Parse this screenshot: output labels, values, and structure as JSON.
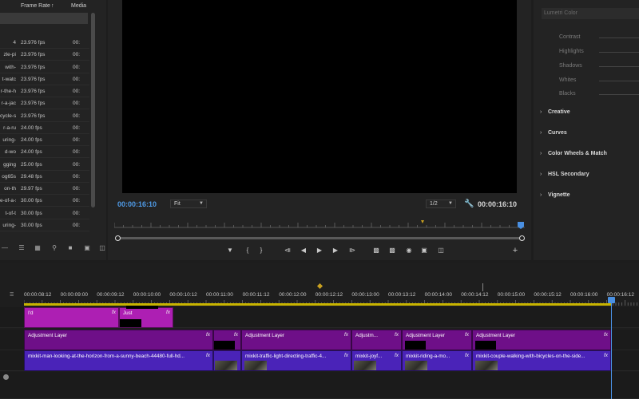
{
  "project": {
    "headers": {
      "frame_rate": "Frame Rate",
      "media": "Media"
    },
    "rows": [
      {
        "name": "4",
        "fps": "23.976 fps",
        "media": "00:"
      },
      {
        "name": "zle-pi",
        "fps": "23.976 fps",
        "media": "00:"
      },
      {
        "name": "with-",
        "fps": "23.976 fps",
        "media": "00:"
      },
      {
        "name": "t-watc",
        "fps": "23.976 fps",
        "media": "00:"
      },
      {
        "name": "r-the-h",
        "fps": "23.976 fps",
        "media": "00:"
      },
      {
        "name": "r-a-jac",
        "fps": "23.976 fps",
        "media": "00:"
      },
      {
        "name": "cycle-s",
        "fps": "23.976 fps",
        "media": "00:"
      },
      {
        "name": "r-a-ru",
        "fps": "24.00 fps",
        "media": "00:"
      },
      {
        "name": "uring-",
        "fps": "24.00 fps",
        "media": "00:"
      },
      {
        "name": "d-wo",
        "fps": "24.00 fps",
        "media": "00:"
      },
      {
        "name": "gging",
        "fps": "25.00 fps",
        "media": "00:"
      },
      {
        "name": "og65s",
        "fps": "29.48 fps",
        "media": "00:"
      },
      {
        "name": "on-th",
        "fps": "29.97 fps",
        "media": "00:"
      },
      {
        "name": "e-of-a-s",
        "fps": "30.00 fps",
        "media": "00:"
      },
      {
        "name": "t-of-t",
        "fps": "30.00 fps",
        "media": "00:"
      },
      {
        "name": "uring-",
        "fps": "30.00 fps",
        "media": "00:"
      }
    ]
  },
  "program": {
    "timecode_current": "00:00:16:10",
    "zoom": "Fit",
    "resolution": "1/2",
    "timecode_duration": "00:00:16:10"
  },
  "lumetri": {
    "clip_selector": "Lumetri Color",
    "sliders": [
      "Contrast",
      "Highlights",
      "Shadows",
      "Whites",
      "Blacks"
    ],
    "sections": [
      "Creative",
      "Curves",
      "Color Wheels & Match",
      "HSL Secondary",
      "Vignette"
    ]
  },
  "timeline": {
    "timecodes": [
      "00:00:08:12",
      "00:00:09:00",
      "00:00:09:12",
      "00:00:10:00",
      "00:00:10:12",
      "00:00:11:00",
      "00:00:11:12",
      "00:00:12:00",
      "00:00:12:12",
      "00:00:13:00",
      "00:00:13:12",
      "00:00:14:00",
      "00:00:14:12",
      "00:00:15:00",
      "00:00:15:12",
      "00:00:16:00",
      "00:00:16:12"
    ],
    "v3_clips": [
      {
        "label": "I'd",
        "fx": "fx"
      },
      {
        "label": "Just",
        "fx": "fx"
      }
    ],
    "v2_clips": [
      {
        "label": "Adjustment Layer",
        "fx": "fx"
      },
      {
        "label": "",
        "fx": "fx"
      },
      {
        "label": "Adjustment Layer",
        "fx": "fx"
      },
      {
        "label": "Adjustm...",
        "fx": "fx"
      },
      {
        "label": "Adjustment Layer",
        "fx": "fx"
      },
      {
        "label": "Adjustment Layer",
        "fx": "fx"
      }
    ],
    "v1_clips": [
      {
        "label": "mixkit-man-looking-at-the-horizon-from-a-sunny-beach-44480-full-hd...",
        "fx": "fx"
      },
      {
        "label": "mixkit-traffic-light-directing-traffic-4...",
        "fx": "fx"
      },
      {
        "label": "mixkit-joyf...",
        "fx": "fx"
      },
      {
        "label": "mixkit-riding-a-mo...",
        "fx": "fx"
      },
      {
        "label": "mixkit-couple-walking-with-bicycles-on-the-side...",
        "fx": "fx"
      }
    ]
  },
  "colors": {
    "accent": "#4f9be8",
    "v3": "#ad1fb3",
    "adjustment": "#6e0f88",
    "video": "#4a23b8",
    "work_area": "#c8b400"
  },
  "icons": [
    "list-view-icon",
    "freeform-view-icon",
    "search-icon",
    "new-bin-icon",
    "new-item-icon",
    "delete-icon",
    "add-marker-icon",
    "mark-in-icon",
    "mark-out-icon",
    "go-to-in-icon",
    "step-back-icon",
    "play-icon",
    "step-forward-icon",
    "go-to-out-icon",
    "lift-icon",
    "extract-icon",
    "export-frame-icon",
    "compare-icon",
    "trim-icon",
    "add-button-icon",
    "wrench-icon"
  ]
}
